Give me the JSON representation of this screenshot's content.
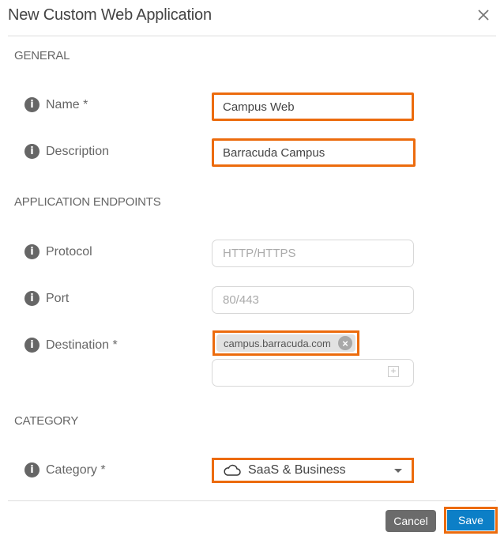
{
  "dialog": {
    "title": "New Custom Web Application",
    "close_icon": "close-icon"
  },
  "sections": {
    "general": "GENERAL",
    "endpoints": "APPLICATION ENDPOINTS",
    "category": "CATEGORY"
  },
  "fields": {
    "name": {
      "label": "Name *",
      "value": "Campus Web"
    },
    "description": {
      "label": "Description",
      "value": "Barracuda Campus"
    },
    "protocol": {
      "label": "Protocol",
      "placeholder": "HTTP/HTTPS"
    },
    "port": {
      "label": "Port",
      "placeholder": "80/443"
    },
    "destination": {
      "label": "Destination *",
      "chips": [
        "campus.barracuda.com"
      ],
      "input_value": ""
    },
    "category": {
      "label": "Category *",
      "selected": "SaaS & Business",
      "icon": "cloud-icon"
    }
  },
  "footer": {
    "cancel_label": "Cancel",
    "save_label": "Save"
  },
  "colors": {
    "highlight": "#ec6b0d",
    "primary": "#0c7fc7",
    "secondary": "#6b6b6b"
  }
}
